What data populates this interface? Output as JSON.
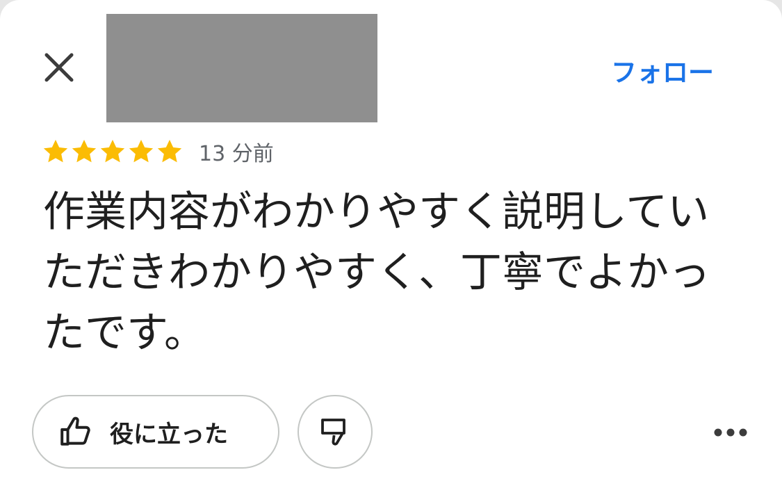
{
  "header": {
    "close_icon": "close-icon",
    "follow_label": "フォロー",
    "accent_color": "#1a73e8",
    "avatar_placeholder_color": "#8f8f8f"
  },
  "review": {
    "rating": 5,
    "rating_max": 5,
    "star_color": "#fbbc04",
    "timestamp": "13 分前",
    "text": "作業内容がわかりやすく説明していただきわかりやすく、丁寧でよかったです。"
  },
  "actions": {
    "helpful_label": "役に立った",
    "helpful_icon": "thumbs-up-icon",
    "not_helpful_icon": "thumbs-down-icon",
    "more_icon": "more-horizontal-icon"
  }
}
